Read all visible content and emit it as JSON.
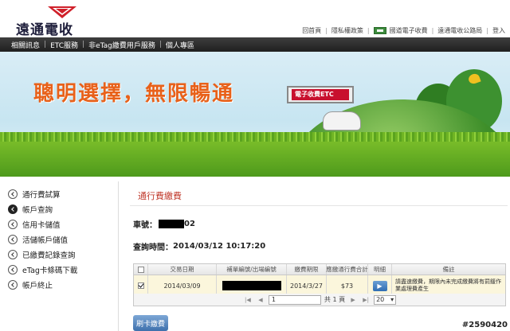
{
  "header": {
    "logo_text": "遠通電收",
    "links": [
      "回首頁",
      "隱私權政策",
      "國道電子收費",
      "遠通電收公路局",
      "登入"
    ]
  },
  "nav": {
    "items": [
      "相關訊息",
      "ETC服務",
      "非eTag繳費用戶服務",
      "個人專區"
    ]
  },
  "banner": {
    "slogan": "聰明選擇，無限暢通",
    "sign": "電子收費ETC"
  },
  "sidebar": {
    "items": [
      {
        "label": "通行費試算",
        "active": false
      },
      {
        "label": "帳戶查詢",
        "active": true
      },
      {
        "label": "信用卡儲值",
        "active": false
      },
      {
        "label": "活儲帳戶儲值",
        "active": false
      },
      {
        "label": "已繳費記錄查詢",
        "active": false
      },
      {
        "label": "eTag卡條碼下載",
        "active": false
      },
      {
        "label": "帳戶終止",
        "active": false
      }
    ]
  },
  "content": {
    "title": "通行費繳費",
    "plate_label": "車號：",
    "plate_suffix": "02",
    "query_time_label": "查詢時間：",
    "query_time": "2014/03/12 10:17:20",
    "table": {
      "headers": [
        "交易日期",
        "補單編號/出場編號",
        "繳費期限",
        "應繳通行費合計",
        "明細",
        "備註"
      ],
      "rows": [
        {
          "checked": true,
          "date": "2014/03/09",
          "deadline": "2014/3/27",
          "amount": "$73",
          "detail_icon": "play-arrow",
          "note": "請盡速繳費，期限內未完成繳費將有罰鍰作業處理費產生"
        }
      ]
    },
    "pager": {
      "page": "1",
      "total_text": "共 1 頁",
      "page_size": "20"
    },
    "pay_button": "刷卡繳費"
  },
  "watermark": "#2590420",
  "colors": {
    "accent_red": "#c0392b",
    "nav_bg": "#2b2b2b",
    "banner_orange": "#e8611a",
    "row_highlight": "#fbf6dc"
  }
}
